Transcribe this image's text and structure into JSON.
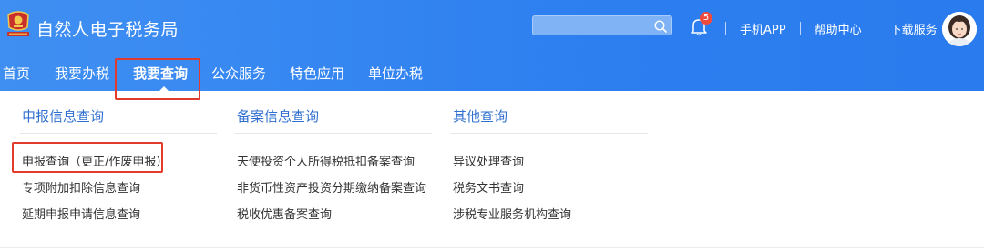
{
  "header": {
    "app_title": "自然人电子税务局",
    "notification_count": "5",
    "links": [
      "手机APP",
      "帮助中心",
      "下载服务"
    ]
  },
  "nav": {
    "items": [
      "首页",
      "我要办税",
      "我要查询",
      "公众服务",
      "特色应用",
      "单位办税"
    ],
    "active_index": 2
  },
  "dropdown": {
    "columns": [
      {
        "title": "申报信息查询",
        "items": [
          "申报查询（更正/作废申报）",
          "专项附加扣除信息查询",
          "延期申报申请信息查询"
        ]
      },
      {
        "title": "备案信息查询",
        "items": [
          "天使投资个人所得税抵扣备案查询",
          "非货币性资产投资分期缴纳备案查询",
          "税收优惠备案查询"
        ]
      },
      {
        "title": "其他查询",
        "items": [
          "异议处理查询",
          "税务文书查询",
          "涉税专业服务机构查询"
        ]
      }
    ]
  },
  "colors": {
    "header_blue": "#2d7ff0",
    "highlight_red": "#e23b2e",
    "column_title_blue": "#2f6fd0"
  }
}
